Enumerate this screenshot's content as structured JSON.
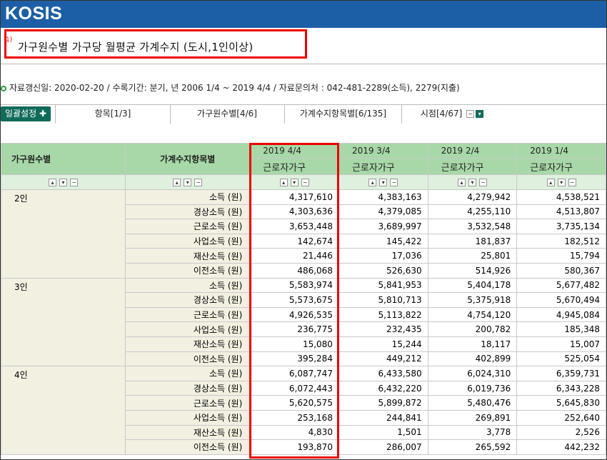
{
  "app": {
    "logo": "KOSIS"
  },
  "title": {
    "note": "1)",
    "text": "가구원수별 가구당 월평균 가계수지 (도시,1인이상)"
  },
  "info": {
    "text": "자료갱신일: 2020-02-20 / 수록기간: 분기, 년 2006 1/4 ~ 2019 4/4 / 자료문의처 : 042-481-2289(소득), 2279(지출)"
  },
  "tabs": {
    "batch_label": "일괄설정",
    "batch_icon": "plus-icon",
    "items": [
      {
        "label": "항목[1/3]"
      },
      {
        "label": "가구원수별[4/6]"
      },
      {
        "label": "가계수지항목별[6/135]"
      },
      {
        "label": "시점[4/67]"
      }
    ]
  },
  "table": {
    "headers": {
      "group": "가구원수별",
      "item": "가계수지항목별"
    },
    "columns": [
      {
        "date": "2019 4/4",
        "kind": "근로자가구"
      },
      {
        "date": "2019 3/4",
        "kind": "근로자가구"
      },
      {
        "date": "2019 2/4",
        "kind": "근로자가구"
      },
      {
        "date": "2019 1/4",
        "kind": "근로자가구"
      }
    ],
    "groups": [
      {
        "label": "2인",
        "rows": [
          {
            "item": "소득 (원)",
            "values": [
              "4,317,610",
              "4,383,163",
              "4,279,942",
              "4,538,521"
            ]
          },
          {
            "item": "경상소득 (원)",
            "values": [
              "4,303,636",
              "4,379,085",
              "4,255,110",
              "4,513,807"
            ]
          },
          {
            "item": "근로소득 (원)",
            "values": [
              "3,653,448",
              "3,689,997",
              "3,532,548",
              "3,735,134"
            ]
          },
          {
            "item": "사업소득 (원)",
            "values": [
              "142,674",
              "145,422",
              "181,837",
              "182,512"
            ]
          },
          {
            "item": "재산소득 (원)",
            "values": [
              "21,446",
              "17,036",
              "25,801",
              "15,794"
            ]
          },
          {
            "item": "이전소득 (원)",
            "values": [
              "486,068",
              "526,630",
              "514,926",
              "580,367"
            ]
          }
        ]
      },
      {
        "label": "3인",
        "rows": [
          {
            "item": "소득 (원)",
            "values": [
              "5,583,974",
              "5,841,953",
              "5,404,178",
              "5,677,482"
            ]
          },
          {
            "item": "경상소득 (원)",
            "values": [
              "5,573,675",
              "5,810,713",
              "5,375,918",
              "5,670,494"
            ]
          },
          {
            "item": "근로소득 (원)",
            "values": [
              "4,926,535",
              "5,113,822",
              "4,754,120",
              "4,945,084"
            ]
          },
          {
            "item": "사업소득 (원)",
            "values": [
              "236,775",
              "232,435",
              "200,782",
              "185,348"
            ]
          },
          {
            "item": "재산소득 (원)",
            "values": [
              "15,080",
              "15,244",
              "18,117",
              "15,007"
            ]
          },
          {
            "item": "이전소득 (원)",
            "values": [
              "395,284",
              "449,212",
              "402,899",
              "525,054"
            ]
          }
        ]
      },
      {
        "label": "4인",
        "rows": [
          {
            "item": "소득 (원)",
            "values": [
              "6,087,747",
              "6,433,580",
              "6,024,310",
              "6,359,731"
            ]
          },
          {
            "item": "경상소득 (원)",
            "values": [
              "6,072,443",
              "6,432,220",
              "6,019,736",
              "6,343,228"
            ]
          },
          {
            "item": "근로소득 (원)",
            "values": [
              "5,620,575",
              "5,899,872",
              "5,480,476",
              "5,645,830"
            ]
          },
          {
            "item": "사업소득 (원)",
            "values": [
              "253,168",
              "244,841",
              "269,891",
              "252,640"
            ]
          },
          {
            "item": "재산소득 (원)",
            "values": [
              "4,830",
              "1,501",
              "3,778",
              "2,526"
            ]
          },
          {
            "item": "이전소득 (원)",
            "values": [
              "193,870",
              "286,007",
              "265,592",
              "442,232"
            ]
          }
        ]
      }
    ]
  },
  "colors": {
    "brand_blue": "#1d5fa6",
    "header_green": "#a8d8a8",
    "row_label_bg": "#f2f0e1",
    "highlight_red": "#e00000",
    "button_teal": "#0f6b5a"
  }
}
